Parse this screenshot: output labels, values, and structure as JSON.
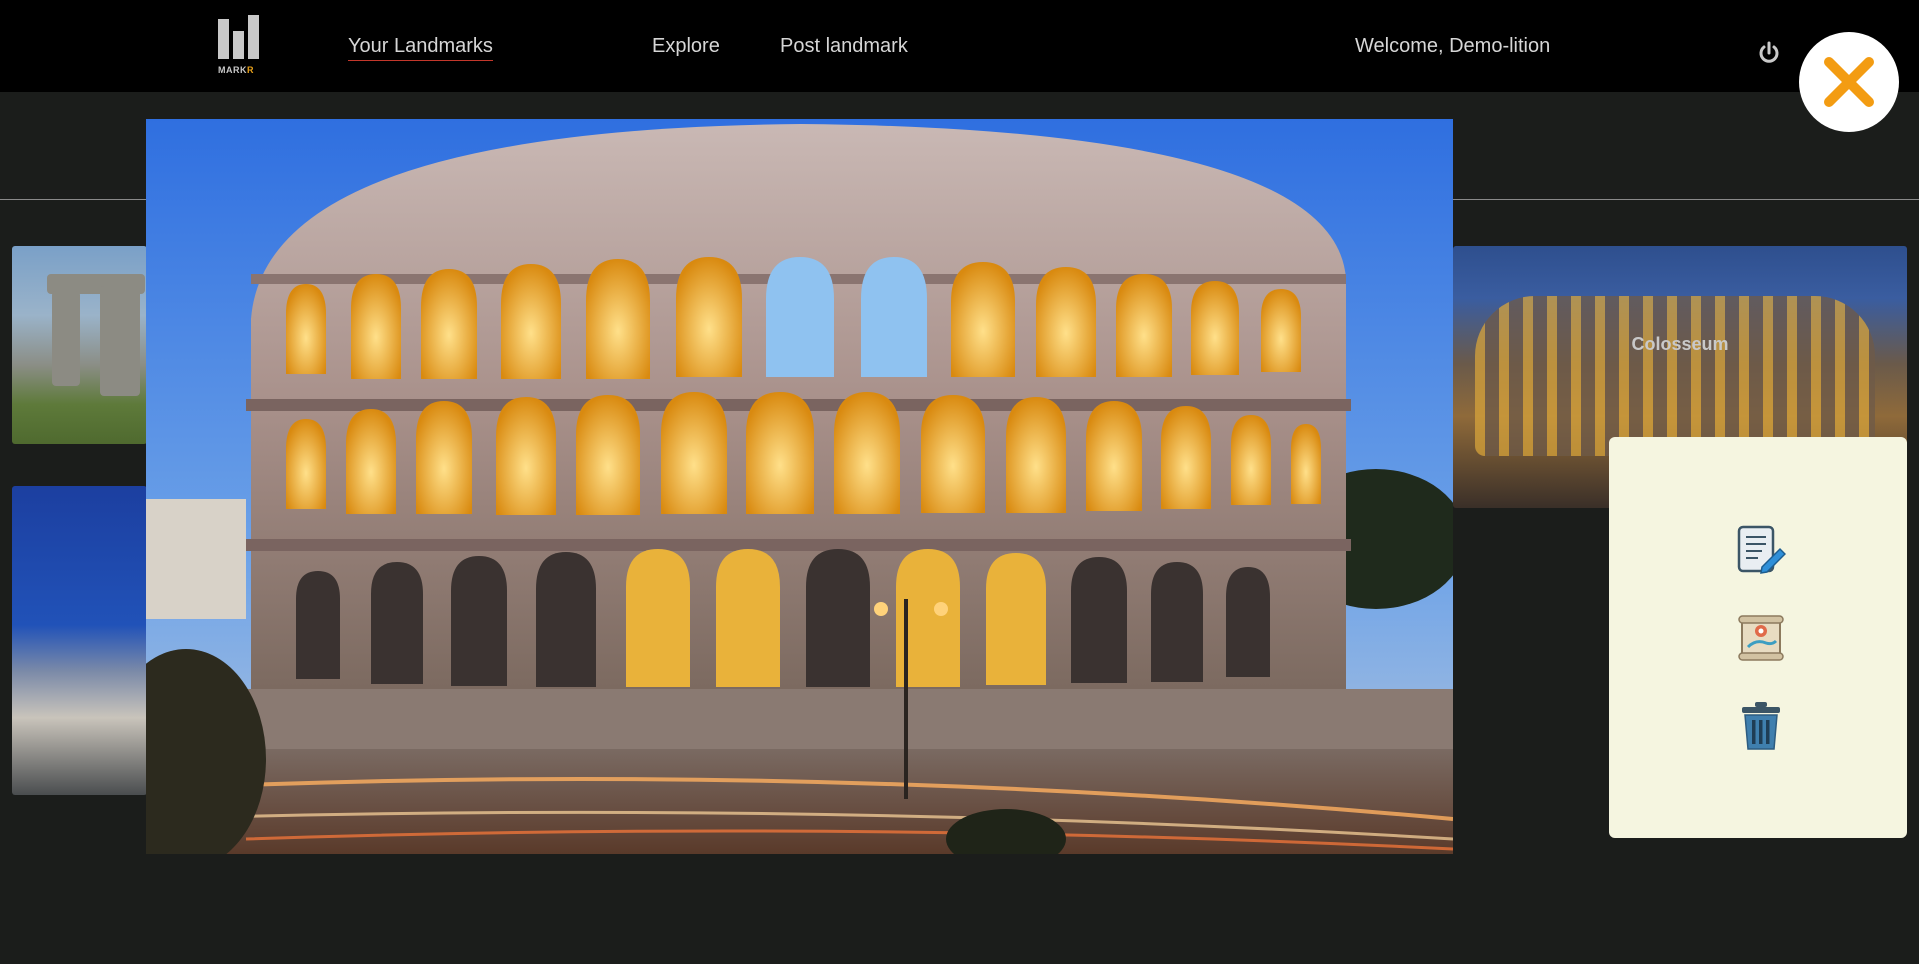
{
  "brand": {
    "name_main": "MARK",
    "name_accent": "R"
  },
  "nav": {
    "your_landmarks": "Your Landmarks",
    "explore": "Explore",
    "post_landmark": "Post landmark",
    "welcome": "Welcome, Demo-lition"
  },
  "cards": [
    {
      "id": "stonehenge",
      "label": ""
    },
    {
      "id": "paris",
      "label": ""
    },
    {
      "id": "colosseum",
      "label": "Colosseum"
    }
  ],
  "actions": {
    "edit": "edit-document-icon",
    "map": "map-scroll-icon",
    "delete": "trash-icon"
  },
  "colors": {
    "accent": "#f39c12",
    "nav_bg": "#000000",
    "page_bg": "#1b1d1b",
    "panel_bg": "#f5f5e0",
    "active_underline": "#c4372b"
  }
}
